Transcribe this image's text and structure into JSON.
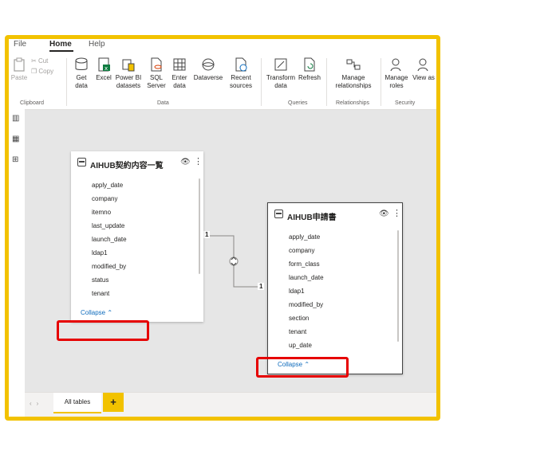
{
  "menu": {
    "tabs": [
      "File",
      "Home",
      "Help"
    ],
    "active": "Home"
  },
  "ribbon": {
    "clipboard": {
      "paste": "Paste",
      "cut": "Cut",
      "copy": "Copy",
      "label": "Clipboard"
    },
    "data": {
      "get_data": "Get data",
      "excel": "Excel",
      "power_bi": "Power BI datasets",
      "sql": "SQL Server",
      "enter": "Enter data",
      "dataverse": "Dataverse",
      "recent": "Recent sources",
      "label": "Data"
    },
    "queries": {
      "transform": "Transform data",
      "refresh": "Refresh",
      "label": "Queries"
    },
    "relationships": {
      "manage": "Manage relationships",
      "label": "Relationships"
    },
    "security": {
      "roles": "Manage roles",
      "view_as": "View as",
      "label": "Security"
    }
  },
  "tables": [
    {
      "title": "AIHUB契約内容一覧",
      "fields": [
        "apply_date",
        "company",
        "itemno",
        "last_update",
        "launch_date",
        "ldap1",
        "modified_by",
        "status",
        "tenant"
      ],
      "collapse": "Collapse"
    },
    {
      "title": "AIHUB申請書",
      "fields": [
        "apply_date",
        "company",
        "form_class",
        "launch_date",
        "ldap1",
        "modified_by",
        "section",
        "tenant",
        "up_date"
      ],
      "collapse": "Collapse"
    }
  ],
  "relationship": {
    "from_card": "1",
    "to_card": "1"
  },
  "bottom": {
    "tab": "All tables",
    "add": "+"
  },
  "colors": {
    "highlight_border": "#f2c200",
    "callout": "#e60000",
    "link": "#0f6cbd"
  }
}
